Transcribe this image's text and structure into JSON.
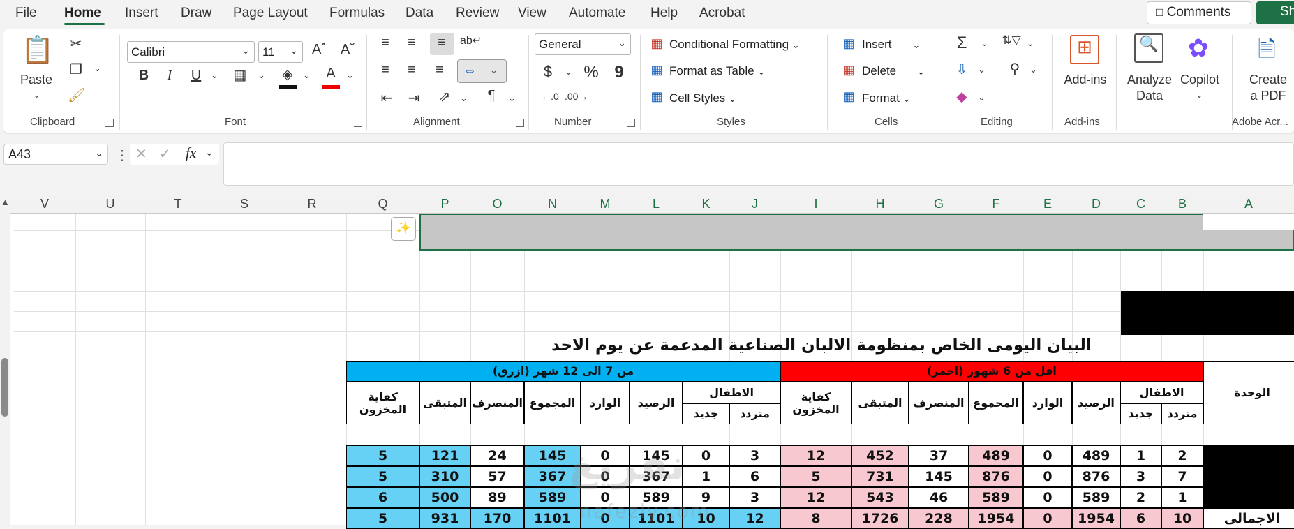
{
  "menu": {
    "items": [
      "File",
      "Home",
      "Insert",
      "Draw",
      "Page Layout",
      "Formulas",
      "Data",
      "Review",
      "View",
      "Automate",
      "Help",
      "Acrobat"
    ],
    "comments": "Comments",
    "share": "Sha"
  },
  "ribbon": {
    "clipboard": {
      "paste": "Paste",
      "label": "Clipboard"
    },
    "font": {
      "name": "Calibri",
      "size": "11",
      "label": "Font",
      "bold": "B",
      "italic": "I",
      "underline": "U"
    },
    "alignment": {
      "label": "Alignment"
    },
    "number": {
      "format": "General",
      "label": "Number",
      "currency": "$",
      "percent": "%",
      "comma": "9"
    },
    "styles": {
      "conditional": "Conditional Formatting",
      "table": "Format as Table",
      "cell": "Cell Styles",
      "label": "Styles"
    },
    "cells": {
      "insert": "Insert",
      "delete": "Delete",
      "format": "Format",
      "label": "Cells"
    },
    "editing": {
      "label": "Editing"
    },
    "addins": {
      "button": "Add-ins",
      "label": "Add-ins"
    },
    "analyze": {
      "line1": "Analyze",
      "line2": "Data"
    },
    "copilot": {
      "button": "Copilot"
    },
    "acrobat": {
      "line1": "Create",
      "line2": "a PDF",
      "label": "Adobe Acr..."
    }
  },
  "formula_bar": {
    "name_box": "A43",
    "fx": "fx",
    "value": ""
  },
  "columns": [
    "V",
    "U",
    "T",
    "S",
    "R",
    "Q",
    "P",
    "O",
    "N",
    "M",
    "L",
    "K",
    "J",
    "I",
    "H",
    "G",
    "F",
    "E",
    "D",
    "C",
    "B",
    "A"
  ],
  "table": {
    "title": "البيان اليومى الخاص بمنظومة الالبان الصناعية المدعمة عن يوم الاحد",
    "red_group": "اقل من 6 شهور (احمر)",
    "blue_group": "من 7 الى 12 شهر (ازرق)",
    "unit_header": "الوحدة",
    "children_header": "الاطفال",
    "sub_repeat": "متردد",
    "sub_new": "جديد",
    "balance": "الرصيد",
    "incoming": "الوارد",
    "total": "المجموع",
    "dispensed": "المنصرف",
    "remaining": "المتبقى",
    "sufficiency": "كفاية المخزون",
    "total_row_label": "الاجمالى",
    "red_rows": [
      [
        "2",
        "1",
        "489",
        "0",
        "489",
        "37",
        "452",
        "12"
      ],
      [
        "7",
        "3",
        "876",
        "0",
        "876",
        "145",
        "731",
        "5"
      ],
      [
        "1",
        "2",
        "589",
        "0",
        "589",
        "46",
        "543",
        "12"
      ],
      [
        "10",
        "6",
        "1954",
        "0",
        "1954",
        "228",
        "1726",
        "8"
      ]
    ],
    "blue_rows": [
      [
        "3",
        "0",
        "145",
        "0",
        "145",
        "24",
        "121",
        "5"
      ],
      [
        "6",
        "1",
        "367",
        "0",
        "367",
        "57",
        "310",
        "5"
      ],
      [
        "3",
        "9",
        "589",
        "0",
        "589",
        "89",
        "500",
        "6"
      ],
      [
        "12",
        "10",
        "1101",
        "0",
        "1101",
        "170",
        "931",
        "5"
      ]
    ],
    "colors": {
      "red": "#ff0000",
      "blue": "#00b0f0",
      "pink": "#f8c8d0",
      "light_blue": "#66d0f5",
      "black": "#000000"
    }
  },
  "watermark": {
    "main": "نفريغ",
    "sub": "nafezly.com"
  }
}
